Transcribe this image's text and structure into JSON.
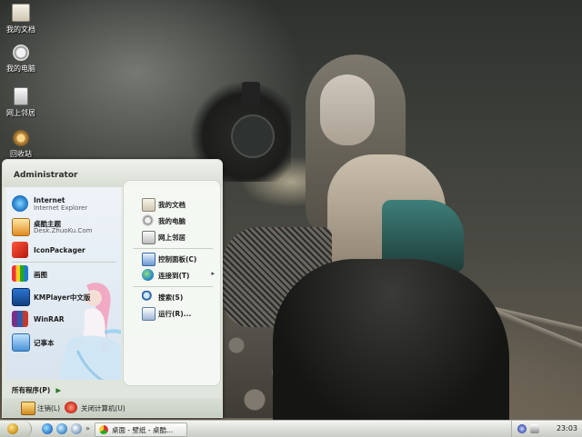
{
  "desktop": {
    "icons": [
      {
        "label": "我的文档",
        "icon": "my-documents-icon"
      },
      {
        "label": "我的电脑",
        "icon": "my-computer-icon"
      },
      {
        "label": "网上邻居",
        "icon": "network-places-icon"
      },
      {
        "label": "回收站",
        "icon": "recycle-bin-icon"
      }
    ]
  },
  "start_menu": {
    "user": "Administrator",
    "left_items": [
      {
        "title": "Internet",
        "subtitle": "Internet Explorer",
        "icon": "internet-explorer-icon"
      },
      {
        "title": "桌酷主题",
        "subtitle": "Desk.ZhuoKu.Com",
        "icon": "zhuoku-icon"
      },
      {
        "title": "IconPackager",
        "subtitle": "",
        "icon": "iconpackager-icon"
      },
      {
        "title": "画图",
        "subtitle": "",
        "icon": "paint-icon"
      },
      {
        "title": "KMPlayer中文版",
        "subtitle": "",
        "icon": "kmplayer-icon"
      },
      {
        "title": "WinRAR",
        "subtitle": "",
        "icon": "winrar-icon"
      },
      {
        "title": "记事本",
        "subtitle": "",
        "icon": "notepad-icon"
      }
    ],
    "all_programs": "所有程序(P)",
    "all_programs_arrow": "▶",
    "right_items": [
      {
        "label": "我的文档",
        "icon": "my-documents-icon",
        "arrow": ""
      },
      {
        "label": "我的电脑",
        "icon": "my-computer-icon",
        "arrow": ""
      },
      {
        "label": "网上邻居",
        "icon": "network-places-icon",
        "arrow": ""
      },
      {
        "label": "控制面板(C)",
        "icon": "control-panel-icon",
        "arrow": ""
      },
      {
        "label": "连接到(T)",
        "icon": "connect-to-icon",
        "arrow": "▸"
      },
      {
        "label": "搜索(S)",
        "icon": "search-icon",
        "arrow": ""
      },
      {
        "label": "运行(R)...",
        "icon": "run-icon",
        "arrow": ""
      }
    ],
    "footer": {
      "logoff": "注销(L)",
      "shutdown": "关闭计算机(U)"
    }
  },
  "taskbar": {
    "quick_arrow": "»",
    "task_button": "桌面 - 壁纸 - 桌酷...",
    "clock": "23:03"
  }
}
